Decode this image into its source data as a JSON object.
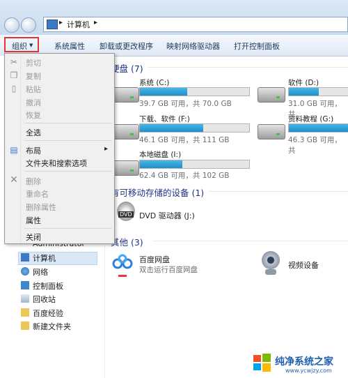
{
  "address": {
    "separator": "▸",
    "location": "计算机",
    "trail_arrow": "▸"
  },
  "toolbar": {
    "organize": "组织",
    "organize_arrow": "▼",
    "buttons": [
      "系统属性",
      "卸载或更改程序",
      "映射网络驱动器",
      "打开控制面板"
    ]
  },
  "menu": {
    "items": [
      {
        "label": "剪切",
        "icon": "scissors-icon",
        "disabled": true
      },
      {
        "label": "复制",
        "icon": "copy-icon",
        "disabled": true
      },
      {
        "label": "粘贴",
        "icon": "paste-icon",
        "disabled": true
      },
      {
        "label": "撤消",
        "disabled": true
      },
      {
        "label": "恢复",
        "disabled": true
      },
      {
        "label": "全选",
        "disabled": false
      },
      {
        "label": "布局",
        "disabled": false,
        "submenu": true
      },
      {
        "label": "文件夹和搜索选项",
        "disabled": false
      },
      {
        "label": "删除",
        "icon": "delete-x-icon",
        "disabled": true
      },
      {
        "label": "重命名",
        "disabled": true
      },
      {
        "label": "删除属性",
        "disabled": true
      },
      {
        "label": "属性",
        "disabled": false
      },
      {
        "label": "关闭",
        "disabled": false
      }
    ],
    "submenu_arrow": "▸"
  },
  "sections": {
    "hdd": "硬盘 (7)",
    "removable": "有可移动存储的设备 (1)",
    "other": "其他 (3)"
  },
  "drives": [
    {
      "name": "系统 (C:)",
      "info": "39.7 GB 可用，共 70.0 GB",
      "used": 0.43
    },
    {
      "name": "软件 (D:)",
      "info": "31.0 GB 可用，共",
      "used": 0.3
    },
    {
      "name": "下载、软件 (F:)",
      "info": "46.1 GB 可用，共 111 GB",
      "used": 0.58
    },
    {
      "name": "资料教程 (G:)",
      "info": "46.3 GB 可用，共",
      "used": 0.6
    },
    {
      "name": "本地磁盘 (I:)",
      "info": "62.4 GB 可用，共 102 GB",
      "used": 0.39
    }
  ],
  "removable": {
    "name": "DVD 驱动器 (J:)",
    "badge": "DVD"
  },
  "other": [
    {
      "name": "百度网盘",
      "sub": "双击运行百度网盘"
    },
    {
      "name": "视频设备"
    }
  ],
  "leftnav": {
    "partial": "Administrator",
    "items": [
      "计算机",
      "网络",
      "控制面板",
      "回收站",
      "百度经验",
      "新建文件夹"
    ]
  },
  "watermark": {
    "main": "纯净系统之家",
    "url": "www.ycwjzy.com"
  },
  "colors": {
    "accent": "#1e3287",
    "bar": "#2a9fd6",
    "highlight": "#e13434"
  }
}
